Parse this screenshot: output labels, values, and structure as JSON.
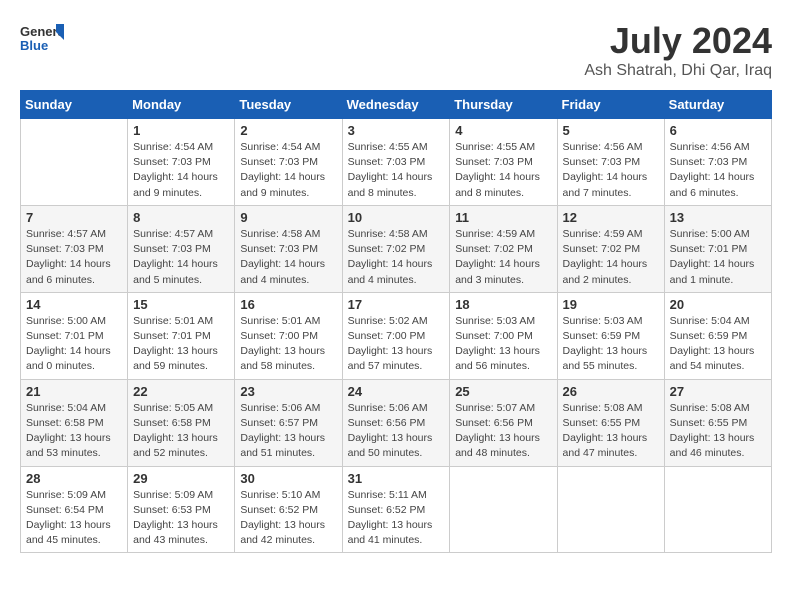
{
  "header": {
    "logo_general": "General",
    "logo_blue": "Blue",
    "title": "July 2024",
    "subtitle": "Ash Shatrah, Dhi Qar, Iraq"
  },
  "days_of_week": [
    "Sunday",
    "Monday",
    "Tuesday",
    "Wednesday",
    "Thursday",
    "Friday",
    "Saturday"
  ],
  "weeks": [
    [
      {
        "day": "",
        "info": ""
      },
      {
        "day": "1",
        "info": "Sunrise: 4:54 AM\nSunset: 7:03 PM\nDaylight: 14 hours\nand 9 minutes."
      },
      {
        "day": "2",
        "info": "Sunrise: 4:54 AM\nSunset: 7:03 PM\nDaylight: 14 hours\nand 9 minutes."
      },
      {
        "day": "3",
        "info": "Sunrise: 4:55 AM\nSunset: 7:03 PM\nDaylight: 14 hours\nand 8 minutes."
      },
      {
        "day": "4",
        "info": "Sunrise: 4:55 AM\nSunset: 7:03 PM\nDaylight: 14 hours\nand 8 minutes."
      },
      {
        "day": "5",
        "info": "Sunrise: 4:56 AM\nSunset: 7:03 PM\nDaylight: 14 hours\nand 7 minutes."
      },
      {
        "day": "6",
        "info": "Sunrise: 4:56 AM\nSunset: 7:03 PM\nDaylight: 14 hours\nand 6 minutes."
      }
    ],
    [
      {
        "day": "7",
        "info": "Sunrise: 4:57 AM\nSunset: 7:03 PM\nDaylight: 14 hours\nand 6 minutes."
      },
      {
        "day": "8",
        "info": "Sunrise: 4:57 AM\nSunset: 7:03 PM\nDaylight: 14 hours\nand 5 minutes."
      },
      {
        "day": "9",
        "info": "Sunrise: 4:58 AM\nSunset: 7:03 PM\nDaylight: 14 hours\nand 4 minutes."
      },
      {
        "day": "10",
        "info": "Sunrise: 4:58 AM\nSunset: 7:02 PM\nDaylight: 14 hours\nand 4 minutes."
      },
      {
        "day": "11",
        "info": "Sunrise: 4:59 AM\nSunset: 7:02 PM\nDaylight: 14 hours\nand 3 minutes."
      },
      {
        "day": "12",
        "info": "Sunrise: 4:59 AM\nSunset: 7:02 PM\nDaylight: 14 hours\nand 2 minutes."
      },
      {
        "day": "13",
        "info": "Sunrise: 5:00 AM\nSunset: 7:01 PM\nDaylight: 14 hours\nand 1 minute."
      }
    ],
    [
      {
        "day": "14",
        "info": "Sunrise: 5:00 AM\nSunset: 7:01 PM\nDaylight: 14 hours\nand 0 minutes."
      },
      {
        "day": "15",
        "info": "Sunrise: 5:01 AM\nSunset: 7:01 PM\nDaylight: 13 hours\nand 59 minutes."
      },
      {
        "day": "16",
        "info": "Sunrise: 5:01 AM\nSunset: 7:00 PM\nDaylight: 13 hours\nand 58 minutes."
      },
      {
        "day": "17",
        "info": "Sunrise: 5:02 AM\nSunset: 7:00 PM\nDaylight: 13 hours\nand 57 minutes."
      },
      {
        "day": "18",
        "info": "Sunrise: 5:03 AM\nSunset: 7:00 PM\nDaylight: 13 hours\nand 56 minutes."
      },
      {
        "day": "19",
        "info": "Sunrise: 5:03 AM\nSunset: 6:59 PM\nDaylight: 13 hours\nand 55 minutes."
      },
      {
        "day": "20",
        "info": "Sunrise: 5:04 AM\nSunset: 6:59 PM\nDaylight: 13 hours\nand 54 minutes."
      }
    ],
    [
      {
        "day": "21",
        "info": "Sunrise: 5:04 AM\nSunset: 6:58 PM\nDaylight: 13 hours\nand 53 minutes."
      },
      {
        "day": "22",
        "info": "Sunrise: 5:05 AM\nSunset: 6:58 PM\nDaylight: 13 hours\nand 52 minutes."
      },
      {
        "day": "23",
        "info": "Sunrise: 5:06 AM\nSunset: 6:57 PM\nDaylight: 13 hours\nand 51 minutes."
      },
      {
        "day": "24",
        "info": "Sunrise: 5:06 AM\nSunset: 6:56 PM\nDaylight: 13 hours\nand 50 minutes."
      },
      {
        "day": "25",
        "info": "Sunrise: 5:07 AM\nSunset: 6:56 PM\nDaylight: 13 hours\nand 48 minutes."
      },
      {
        "day": "26",
        "info": "Sunrise: 5:08 AM\nSunset: 6:55 PM\nDaylight: 13 hours\nand 47 minutes."
      },
      {
        "day": "27",
        "info": "Sunrise: 5:08 AM\nSunset: 6:55 PM\nDaylight: 13 hours\nand 46 minutes."
      }
    ],
    [
      {
        "day": "28",
        "info": "Sunrise: 5:09 AM\nSunset: 6:54 PM\nDaylight: 13 hours\nand 45 minutes."
      },
      {
        "day": "29",
        "info": "Sunrise: 5:09 AM\nSunset: 6:53 PM\nDaylight: 13 hours\nand 43 minutes."
      },
      {
        "day": "30",
        "info": "Sunrise: 5:10 AM\nSunset: 6:52 PM\nDaylight: 13 hours\nand 42 minutes."
      },
      {
        "day": "31",
        "info": "Sunrise: 5:11 AM\nSunset: 6:52 PM\nDaylight: 13 hours\nand 41 minutes."
      },
      {
        "day": "",
        "info": ""
      },
      {
        "day": "",
        "info": ""
      },
      {
        "day": "",
        "info": ""
      }
    ]
  ]
}
